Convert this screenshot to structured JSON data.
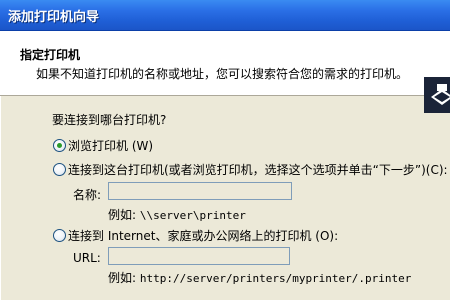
{
  "window": {
    "title": "添加打印机向导"
  },
  "header": {
    "title": "指定打印机",
    "subtitle": "如果不知道打印机的名称或地址，您可以搜索符合您的需求的打印机。",
    "icon": "printer-icon"
  },
  "main": {
    "question": "要连接到哪台打印机?",
    "options": [
      {
        "label": "浏览打印机 (W)",
        "checked": true
      },
      {
        "label": "连接到这台打印机(或者浏览打印机，选择这个选项并单击“下一步”)(C):",
        "checked": false
      },
      {
        "label": "连接到 Internet、家庭或办公网络上的打印机 (O):",
        "checked": false
      }
    ],
    "name_field": {
      "label": "名称:",
      "value": "",
      "example_prefix": "例如:",
      "example_value": "\\\\server\\printer"
    },
    "url_field": {
      "label": "URL:",
      "value": "",
      "example_prefix": "例如:",
      "example_value": "http://server/printers/myprinter/.printer"
    }
  }
}
